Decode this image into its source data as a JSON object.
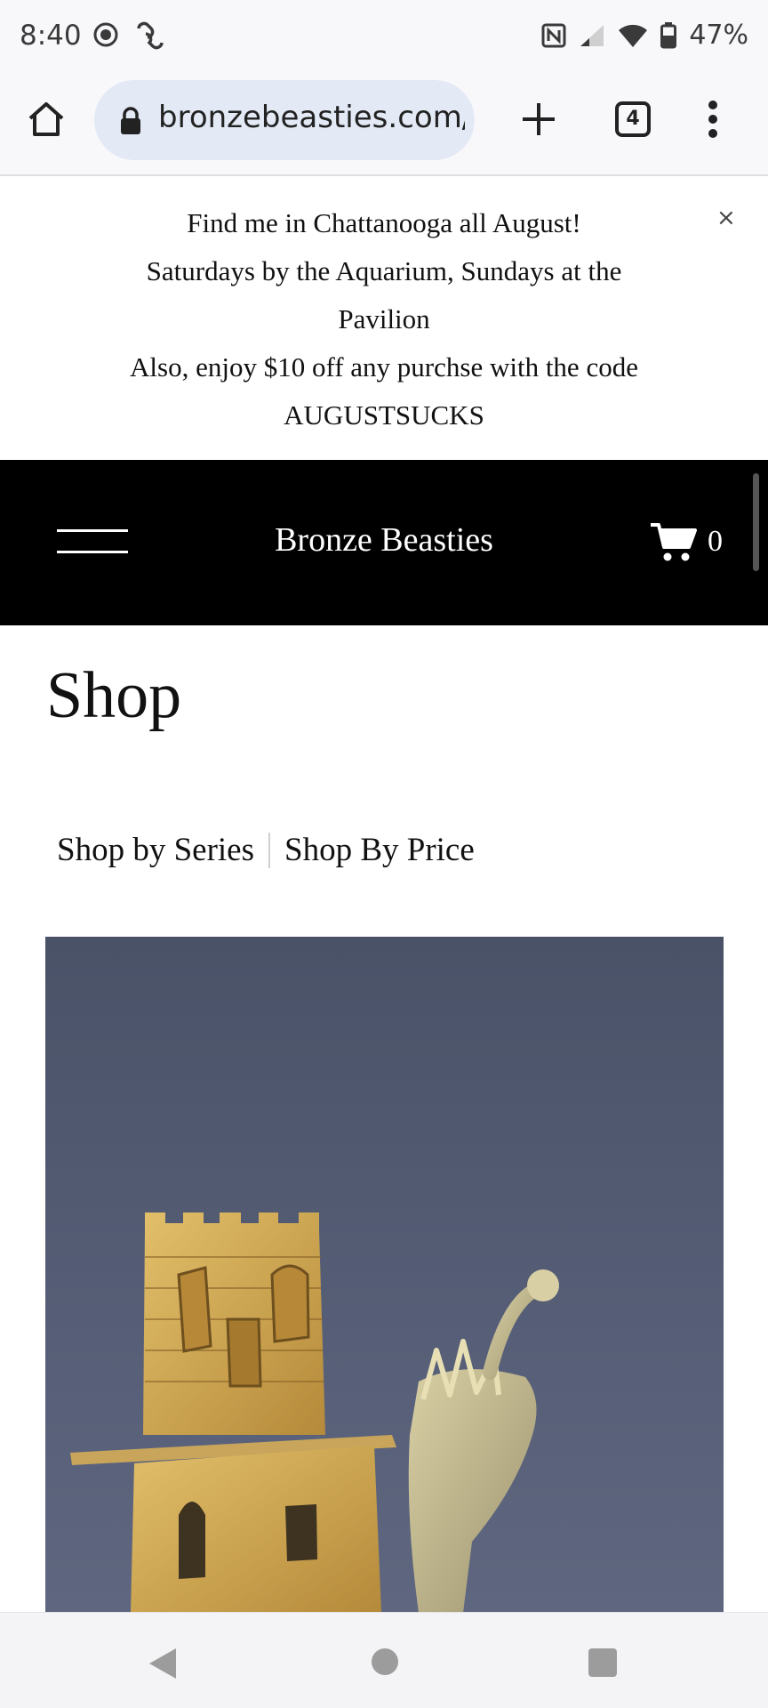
{
  "status_bar": {
    "time": "8:40",
    "left_icons": [
      "screen-record-icon",
      "link-icon"
    ],
    "right_icons": [
      "nfc-icon",
      "signal-icon",
      "wifi-icon",
      "battery-icon"
    ],
    "battery": "47%"
  },
  "browser": {
    "url": "bronzebeasties.com/",
    "tab_count": "4",
    "icons": [
      "home-icon",
      "lock-icon",
      "plus-icon",
      "tabs-icon",
      "more-vert-icon"
    ]
  },
  "announcement": {
    "lines": [
      "Find me in Chattanooga all August!",
      "Saturdays by the Aquarium, Sundays at the",
      "Pavilion",
      "Also, enjoy $10 off any purchse with the code",
      "AUGUSTSUCKS"
    ],
    "close_label": "×"
  },
  "header": {
    "site_title": "Bronze Beasties",
    "cart_count": "0"
  },
  "shop": {
    "title": "Shop",
    "links": [
      "Shop by Series",
      "Shop By Price"
    ]
  },
  "product": {
    "image_subject": "bronze castle tower and creature sculpture"
  },
  "colors": {
    "header_bg": "#000000",
    "url_pill": "#e3eaf6",
    "image_bg": "#4f576f",
    "bronze": "#c9a24e"
  },
  "nav_bar": {
    "icons": [
      "back-icon",
      "home-circle-icon",
      "recents-icon"
    ]
  }
}
